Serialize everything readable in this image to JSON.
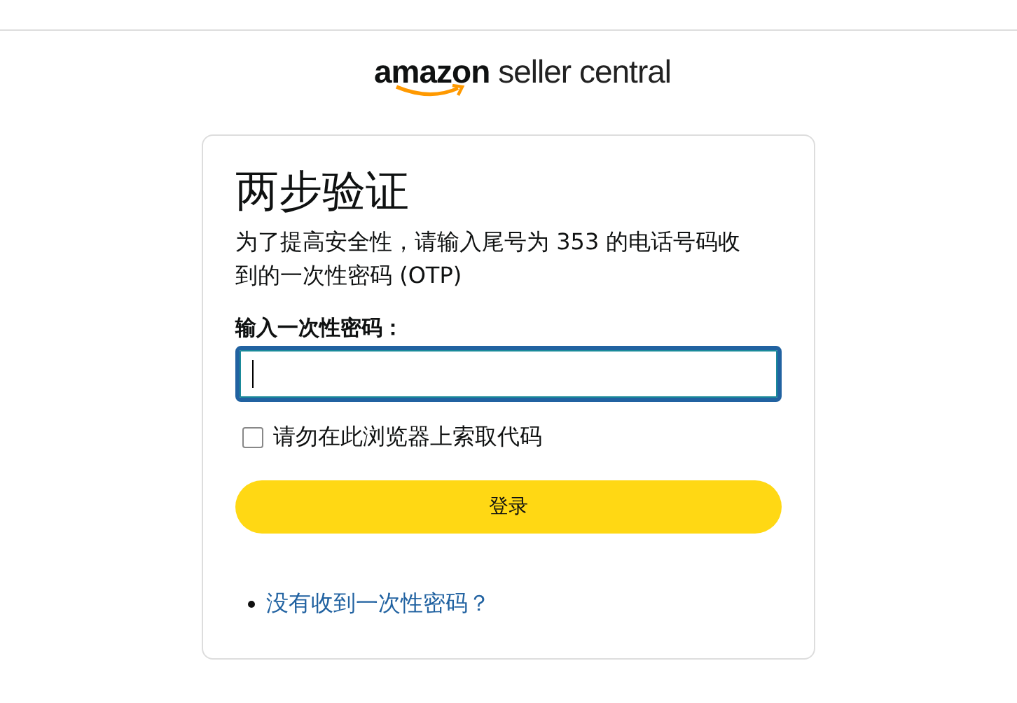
{
  "logo": {
    "brand": "amazon",
    "product": "seller central"
  },
  "title": "两步验证",
  "description": "为了提高安全性，请输入尾号为 353 的电话号码收到的一次性密码 (OTP)",
  "otp_field": {
    "label": "输入一次性密码：",
    "focused": true
  },
  "remember_checkbox": {
    "label": "请勿在此浏览器上索取代码",
    "checked": false
  },
  "submit_button": "登录",
  "help_links": [
    "没有收到一次性密码？"
  ]
}
